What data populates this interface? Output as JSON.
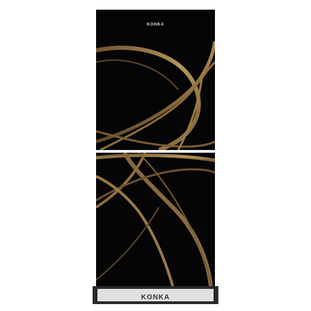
{
  "product": {
    "name": "refrigerator",
    "brand_top": "KONKA",
    "brand_bottom": "KONKA"
  },
  "colors": {
    "door": "#050505",
    "swirl_dark": "#6e5530",
    "swirl_light": "#b8965c",
    "divider": "#f2f2f2",
    "base_plate": "#e0e0e0",
    "base_dark": "#2a2a2a"
  }
}
